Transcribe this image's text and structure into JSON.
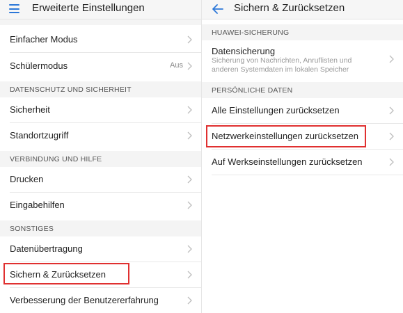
{
  "left": {
    "title": "Erweiterte Einstellungen",
    "rows_top": [
      {
        "label": "Einfacher Modus",
        "value": ""
      },
      {
        "label": "Schülermodus",
        "value": "Aus"
      }
    ],
    "sections": [
      {
        "header": "DATENSCHUTZ UND SICHERHEIT",
        "rows": [
          "Sicherheit",
          "Standortzugriff"
        ]
      },
      {
        "header": "VERBINDUNG UND HILFE",
        "rows": [
          "Drucken",
          "Eingabehilfen"
        ]
      },
      {
        "header": "SONSTIGES",
        "rows": [
          "Datenübertragung",
          "Sichern & Zurücksetzen",
          "Verbesserung der Benutzererfahrung"
        ]
      }
    ]
  },
  "right": {
    "title": "Sichern & Zurücksetzen",
    "sections": [
      {
        "header": "HUAWEI-SICHERUNG"
      },
      {
        "header": "PERSÖNLICHE DATEN"
      }
    ],
    "backup": {
      "label": "Datensicherung",
      "description": "Sicherung von Nachrichten, Anruflisten und anderen Systemdaten im lokalen Speicher"
    },
    "personal_rows": [
      "Alle Einstellungen zurücksetzen",
      "Netzwerkeinstellungen zurücksetzen",
      "Auf Werkseinstellungen zurücksetzen"
    ]
  },
  "colors": {
    "accent": "#2b77d8",
    "highlight": "#e03030"
  },
  "icons": {
    "menu": "menu-icon",
    "back": "arrow-left-icon",
    "chevron": "chevron-right-icon"
  }
}
